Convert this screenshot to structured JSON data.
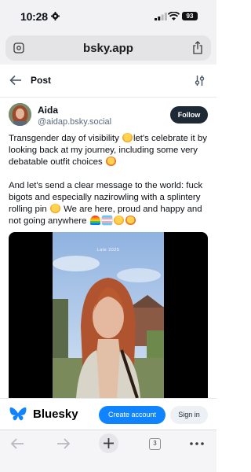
{
  "status_bar": {
    "time": "10:28",
    "battery": "93"
  },
  "browser": {
    "url": "bsky.app"
  },
  "header": {
    "title": "Post"
  },
  "post": {
    "author_name": "Aida",
    "author_handle": "@aidap.bsky.social",
    "follow_label": "Follow",
    "paragraph1": {
      "part1": "Transgender day of visibility",
      "part2": "let's celebrate it by looking back at my journey, including some very debatable outfit choices"
    },
    "paragraph2": {
      "part1": "And let's send a clear message to the world: fuck bigots and especially nazirowling with a splintery rolling pin",
      "part2": "We are here, proud and happy and not going anywhere"
    },
    "image_caption": "Late 2025"
  },
  "banner": {
    "brand": "Bluesky",
    "create_account_label": "Create account",
    "sign_in_label": "Sign in",
    "brand_color": "#1083fe"
  },
  "toolbar": {
    "tabs_count": "3"
  },
  "icons": {
    "status": [
      "gear-icon",
      "signal-icon",
      "wifi-icon",
      "battery-icon"
    ],
    "browser": [
      "site-settings-icon",
      "share-icon"
    ],
    "header": [
      "back-arrow-icon",
      "settings-sliders-icon"
    ],
    "toolbar": [
      "back-icon",
      "forward-icon",
      "plus-icon",
      "tabs-icon",
      "more-icon"
    ]
  }
}
